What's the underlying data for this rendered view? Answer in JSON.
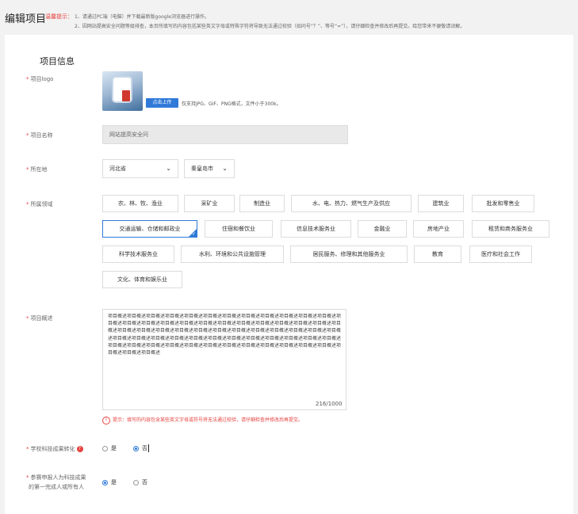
{
  "header": {
    "title": "编辑项目",
    "tip_label": "温馨提示：",
    "tip_1": "1、请通过PC端（电脑）并下载最新版google浏览器进行操作。",
    "tip_2": "2、因网站提高安全问题等级排查，本页所填写的内容包括某些英文字母或特殊字符将导致无法通过校验（如问号“？”、等号“=”），请仔细检查并修改后再提交。给您带来不便敬请谅解。"
  },
  "section": {
    "title": "项目信息"
  },
  "logo": {
    "label": "项目logo",
    "upload_label": "点击上传",
    "hint": "仅支持JPG、GIF、PNG格式，文件小于300k。"
  },
  "name": {
    "label": "项目名称",
    "value": "网站提高安全问"
  },
  "location": {
    "label": "所在地",
    "province": "河北省",
    "city": "秦皇岛市"
  },
  "industry": {
    "label": "所属领域",
    "selected": "交通运输、仓储和邮政业",
    "items": [
      "农、林、牧、渔业",
      "采矿业",
      "制造业",
      "水、电、热力、燃气生产及供应",
      "建筑业",
      "批发和零售业",
      "交通运输、仓储和邮政业",
      "住宿和餐饮业",
      "信息技术服务业",
      "金融业",
      "房地产业",
      "租赁和商务服务业",
      "科学技术服务业",
      "水利、环境和公共设施管理",
      "居民服务、修理和其他服务业",
      "教育",
      "医疗和社会工作",
      "文化、体育和娱乐业"
    ]
  },
  "overview": {
    "label": "项目概述",
    "text": "项目概述项目概述项目概述项目概述项目概述项目概述项目概述项目概述项目概述项目概述项目概述项目概述项目概述项目概述项目概述项目概述项目概述项目概述项目概述项目概述项目概述项目概述项目概述项目概述项目概述项目概述项目概述项目概述项目概述项目概述项目概述项目概述项目概述项目概述项目概述项目概述项目概述项目概述项目概述项目概述项目概述项目概述项目概述项目概述项目概述项目概述项目概述项目概述项目概述项目概述项目概述项目概述项目概述项目概述项目概述项目概述项目概述项目概述项目概述项目概述项目概述项目概述项目概述项目概述",
    "counter": "216/1000",
    "warning": "提示：填写的内容包含某些英文字母或符号将无法通过校验，请仔细检查并修改后再提交。"
  },
  "transfer": {
    "label": "学校科技成果转化",
    "yes": "是",
    "no": "否",
    "selected": "否"
  },
  "first_person": {
    "label_1": "参赛申报人为科技成果",
    "label_2": "的第一完成人或所有人",
    "yes": "是",
    "no": "否",
    "selected": "是"
  },
  "colors": {
    "accent": "#2f7ad8",
    "required": "#e64340"
  }
}
